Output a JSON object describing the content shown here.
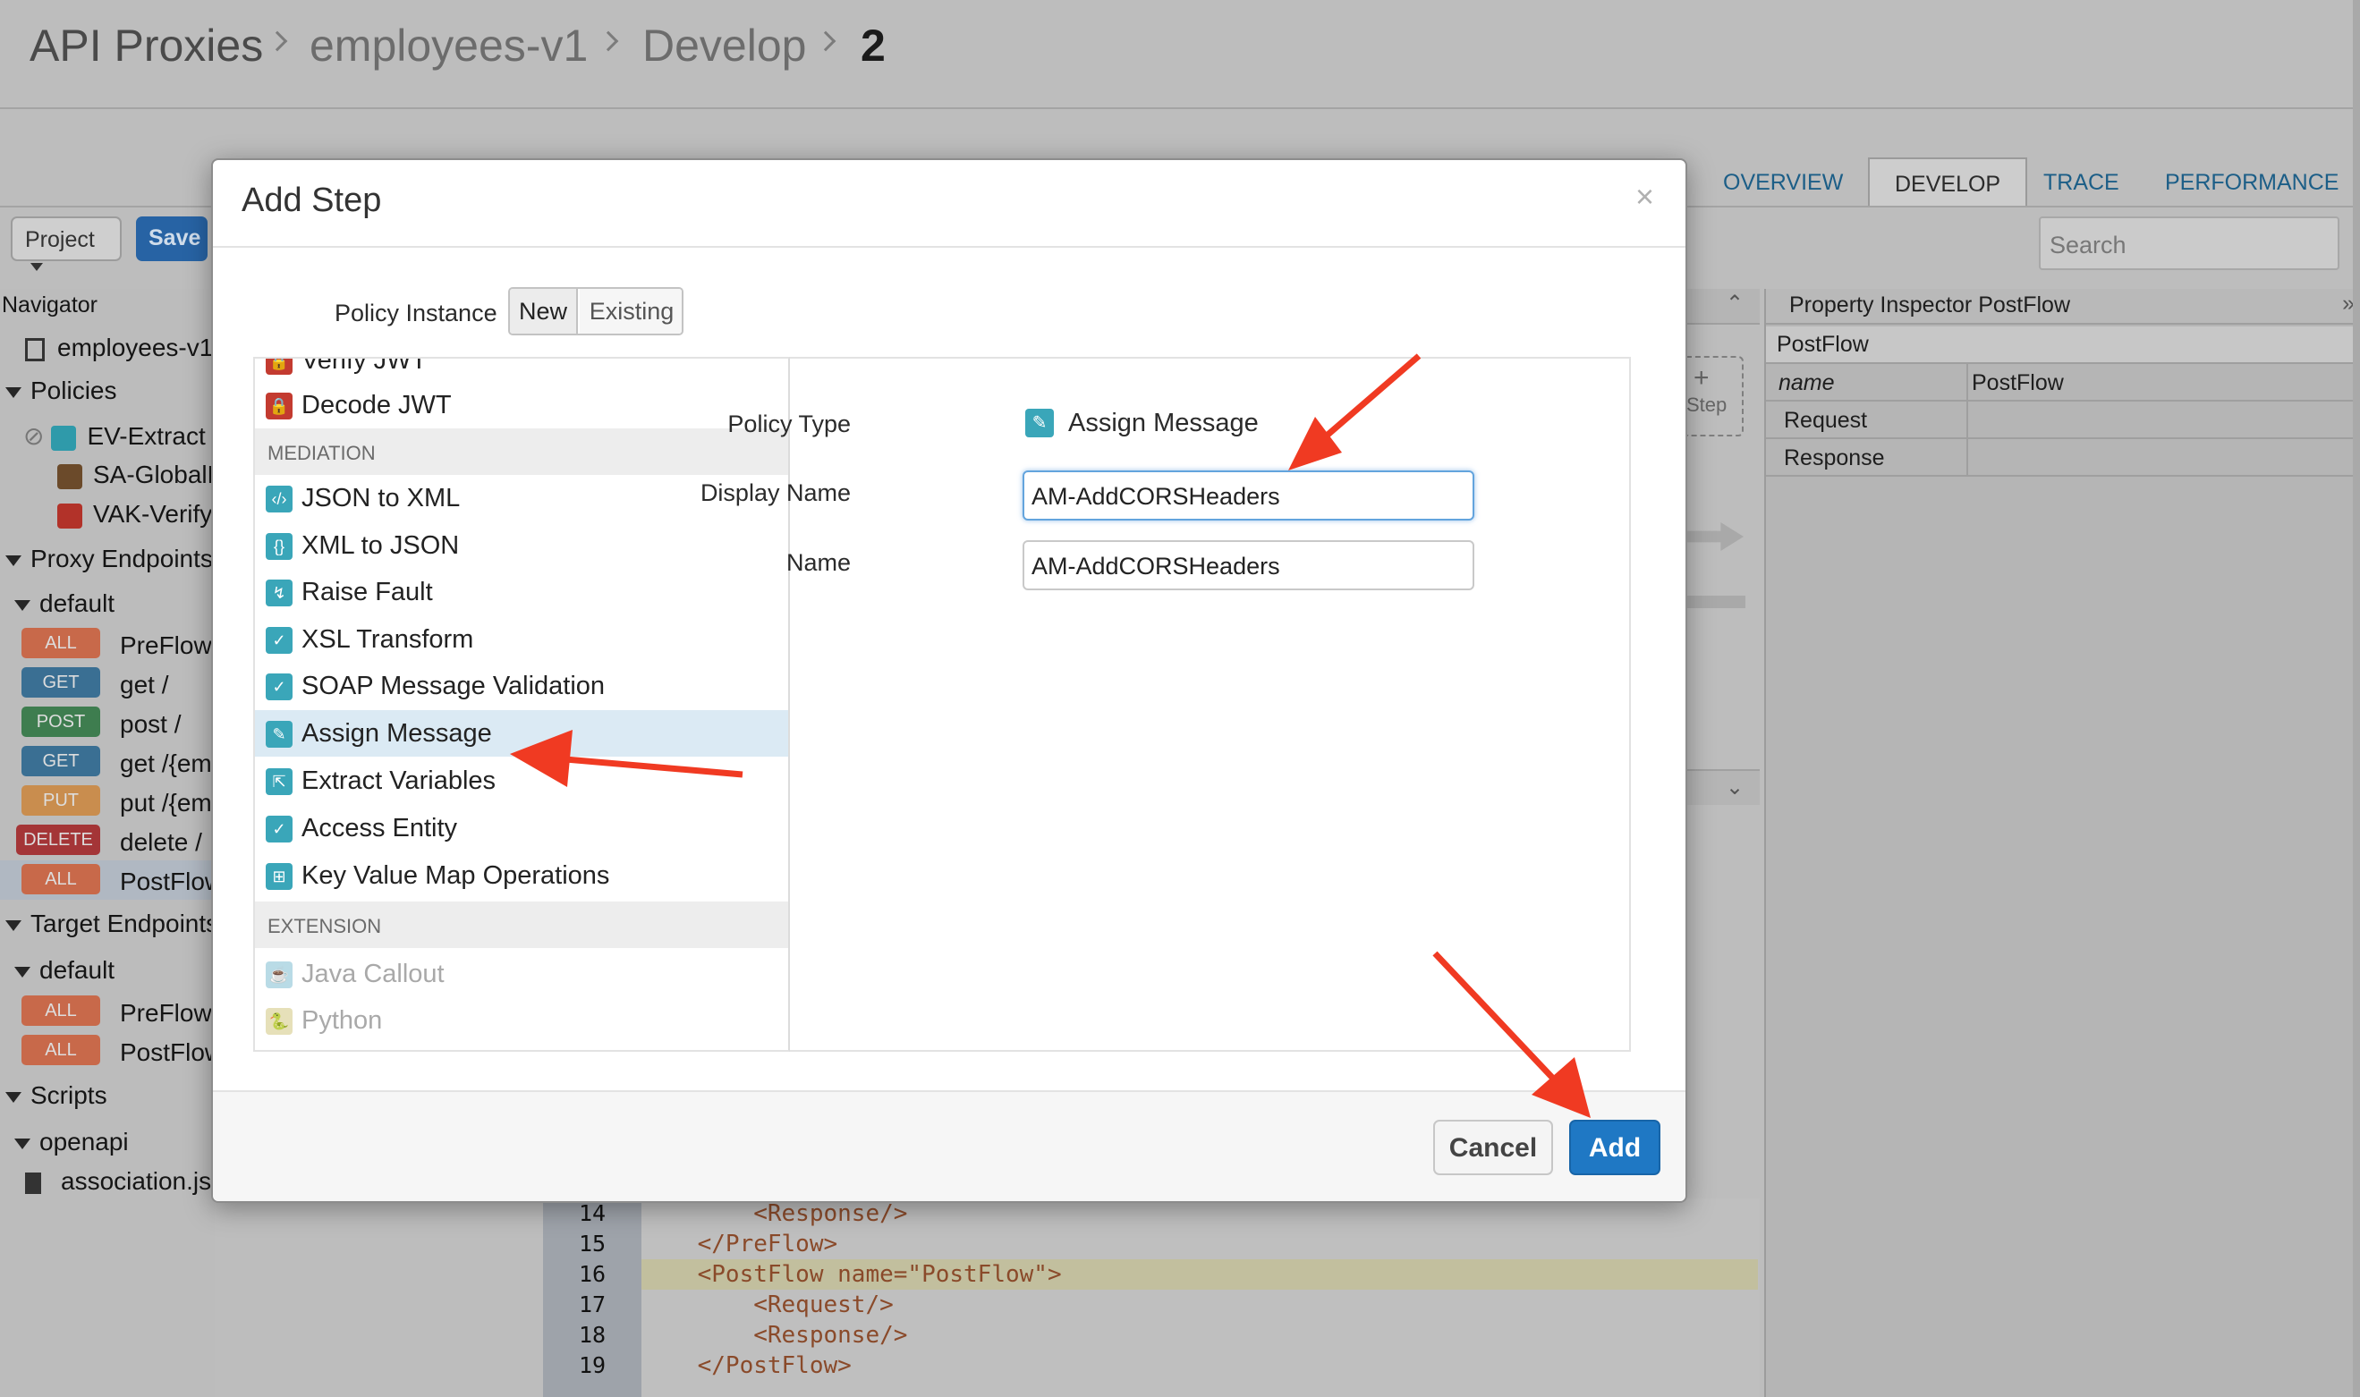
{
  "breadcrumb": {
    "items": [
      "API Proxies",
      "employees-v1",
      "Develop"
    ],
    "current": "2"
  },
  "tabs": [
    "OVERVIEW",
    "DEVELOP",
    "TRACE",
    "PERFORMANCE"
  ],
  "toolbar": {
    "project_label": "Project",
    "save_label": "Save",
    "search_placeholder": "Search"
  },
  "navigator": {
    "title": "Navigator",
    "root": "employees-v1",
    "policies_label": "Policies",
    "policies": [
      "EV-Extract",
      "SA-GlobalR",
      "VAK-Verify"
    ],
    "proxy_endpoints_label": "Proxy Endpoints",
    "proxy_default": "default",
    "proxy_flows": [
      {
        "verb": "ALL",
        "label": "PreFlow",
        "color": "#c8694a"
      },
      {
        "verb": "GET",
        "label": "get /",
        "color": "#3a6f93"
      },
      {
        "verb": "POST",
        "label": "post /",
        "color": "#3e7d4f"
      },
      {
        "verb": "GET",
        "label": "get /{em",
        "color": "#3a6f93"
      },
      {
        "verb": "PUT",
        "label": "put /{em",
        "color": "#c98d4e"
      },
      {
        "verb": "DELETE",
        "label": "delete /",
        "color": "#a43537"
      },
      {
        "verb": "ALL",
        "label": "PostFlow",
        "color": "#c8694a"
      }
    ],
    "target_endpoints_label": "Target Endpoints",
    "target_default": "default",
    "target_flows": [
      {
        "verb": "ALL",
        "label": "PreFlow",
        "color": "#c8694a"
      },
      {
        "verb": "ALL",
        "label": "PostFlow",
        "color": "#c8694a"
      }
    ],
    "scripts_label": "Scripts",
    "scripts_folder": "openapi",
    "scripts_file": "association.js"
  },
  "canvas": {
    "step_label": "Step",
    "plus": "+"
  },
  "inspector": {
    "title": "Property Inspector  PostFlow",
    "section": "PostFlow",
    "rows": [
      {
        "key": "name",
        "value": "PostFlow"
      },
      {
        "key": "Request",
        "value": ""
      },
      {
        "key": "Response",
        "value": ""
      }
    ]
  },
  "editor": {
    "lines": [
      {
        "num": "14",
        "code": "        <Response/>"
      },
      {
        "num": "15",
        "code": "    </PreFlow>"
      },
      {
        "num": "16",
        "code": "    <PostFlow name=\"PostFlow\">"
      },
      {
        "num": "17",
        "code": "        <Request/>"
      },
      {
        "num": "18",
        "code": "        <Response/>"
      },
      {
        "num": "19",
        "code": "    </PostFlow>"
      }
    ]
  },
  "modal": {
    "title": "Add Step",
    "close": "×",
    "policy_instance_label": "Policy Instance",
    "instance_options": [
      "New",
      "Existing"
    ],
    "policies_top": [
      {
        "label": "Verify JWT",
        "icon": "lock-icon",
        "color": "#c33b30"
      },
      {
        "label": "Decode JWT",
        "icon": "lock-icon",
        "color": "#c33b30"
      }
    ],
    "cat_mediation": "MEDIATION",
    "mediation": [
      {
        "label": "JSON to XML",
        "icon": "code-icon",
        "color": "#3aa6b9"
      },
      {
        "label": "XML to JSON",
        "icon": "braces-icon",
        "color": "#3aa6b9"
      },
      {
        "label": "Raise Fault",
        "icon": "fault-icon",
        "color": "#3aa6b9"
      },
      {
        "label": "XSL Transform",
        "icon": "cloud-check-icon",
        "color": "#3aa6b9"
      },
      {
        "label": "SOAP Message Validation",
        "icon": "cloud-check-icon",
        "color": "#3aa6b9"
      },
      {
        "label": "Assign Message",
        "icon": "pencil-icon",
        "color": "#3aa6b9"
      },
      {
        "label": "Extract Variables",
        "icon": "extract-icon",
        "color": "#3aa6b9"
      },
      {
        "label": "Access Entity",
        "icon": "cloud-check-icon",
        "color": "#3aa6b9"
      },
      {
        "label": "Key Value Map Operations",
        "icon": "kvm-icon",
        "color": "#3aa6b9"
      }
    ],
    "cat_extension": "EXTENSION",
    "extension": [
      {
        "label": "Java Callout",
        "icon": "java-icon",
        "color": "#b9dbe6"
      },
      {
        "label": "Python",
        "icon": "python-icon",
        "color": "#e6e0b9"
      }
    ],
    "policy_type_label": "Policy Type",
    "policy_type_value": "Assign Message",
    "display_name_label": "Display Name",
    "display_name_value": "AM-AddCORSHeaders",
    "name_label": "Name",
    "name_value": "AM-AddCORSHeaders",
    "cancel_label": "Cancel",
    "add_label": "Add"
  },
  "colors": {
    "accent": "#1f78c4",
    "annotation_arrow": "#f03a22",
    "link": "#1c5e87"
  }
}
